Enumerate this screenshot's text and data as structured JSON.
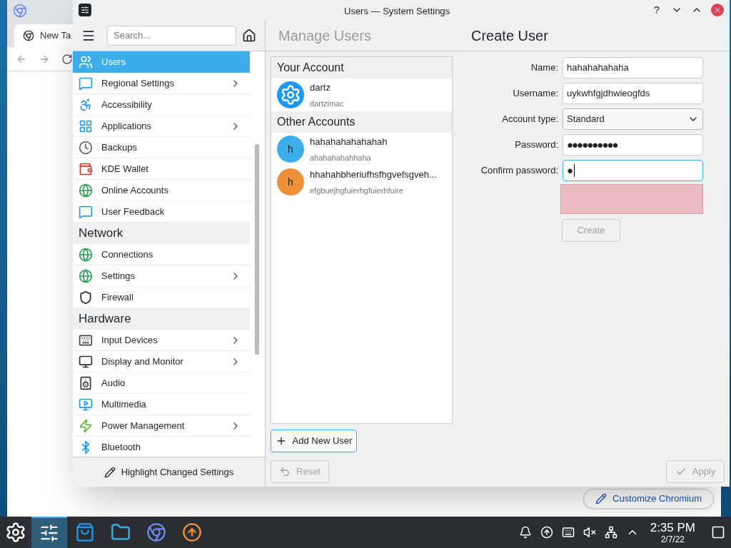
{
  "browser": {
    "tab_title": "New Ta",
    "customize_button": "Customize Chromium"
  },
  "window": {
    "title": "Users — System Settings",
    "help": "?"
  },
  "sidebar": {
    "search": {
      "placeholder": "Search..."
    },
    "groups": [
      {
        "items": [
          {
            "label": "Users",
            "selected": true,
            "has_children": false
          },
          {
            "label": "Regional Settings",
            "selected": false,
            "has_children": true
          },
          {
            "label": "Accessibility",
            "selected": false,
            "has_children": false
          },
          {
            "label": "Applications",
            "selected": false,
            "has_children": true
          },
          {
            "label": "Backups",
            "selected": false,
            "has_children": false
          },
          {
            "label": "KDE Wallet",
            "selected": false,
            "has_children": false
          },
          {
            "label": "Online Accounts",
            "selected": false,
            "has_children": false
          },
          {
            "label": "User Feedback",
            "selected": false,
            "has_children": false
          }
        ]
      },
      {
        "header": "Network",
        "items": [
          {
            "label": "Connections",
            "selected": false,
            "has_children": false
          },
          {
            "label": "Settings",
            "selected": false,
            "has_children": true
          },
          {
            "label": "Firewall",
            "selected": false,
            "has_children": false
          }
        ]
      },
      {
        "header": "Hardware",
        "items": [
          {
            "label": "Input Devices",
            "selected": false,
            "has_children": true
          },
          {
            "label": "Display and Monitor",
            "selected": false,
            "has_children": true
          },
          {
            "label": "Audio",
            "selected": false,
            "has_children": false
          },
          {
            "label": "Multimedia",
            "selected": false,
            "has_children": false
          },
          {
            "label": "Power Management",
            "selected": false,
            "has_children": true
          },
          {
            "label": "Bluetooth",
            "selected": false,
            "has_children": false
          }
        ]
      }
    ],
    "footer_button": "Highlight Changed Settings"
  },
  "breadcrumbs": [
    {
      "label": "Manage Users",
      "active": false
    },
    {
      "label": "Create User",
      "active": true
    }
  ],
  "accounts": [
    {
      "header": "Your Account",
      "users": [
        {
          "kind": "logo",
          "name": "dartz",
          "username": "dartzimac"
        }
      ]
    },
    {
      "header": "Other Accounts",
      "users": [
        {
          "kind": "letter",
          "letter": "h",
          "color": "#3daee9",
          "name": "hahahahahahahah",
          "username": "ahahahahahhaha"
        },
        {
          "kind": "letter",
          "letter": "h",
          "color": "#f08f3a",
          "name": "hhahahbheriufhsfhgvefsgveh...",
          "username": "efgbuejhgfuierhgfuierhfuire"
        }
      ]
    }
  ],
  "add_user_button": "Add New User",
  "form": {
    "fields": [
      {
        "kind": "text",
        "label": "Name:",
        "value": "hahahahahaha",
        "focused": false
      },
      {
        "kind": "text",
        "label": "Username:",
        "value": "uykwhfgjdhwieogfds",
        "focused": false
      },
      {
        "kind": "select",
        "label": "Account type:",
        "value": "Standard",
        "focused": false
      },
      {
        "kind": "password",
        "label": "Password:",
        "value": "●●●●●●●●●●",
        "focused": false
      },
      {
        "kind": "password",
        "label": "Confirm password:",
        "value": "●",
        "focused": true
      }
    ],
    "error": true,
    "create_button": {
      "label": "Create",
      "disabled": true
    }
  },
  "footer": {
    "reset": {
      "label": "Reset",
      "disabled": true
    },
    "apply": {
      "label": "Apply",
      "disabled": true
    }
  },
  "taskbar": {
    "apps": [
      {
        "selected": true
      },
      {
        "selected": false
      },
      {
        "selected": false
      },
      {
        "selected": false
      },
      {
        "selected": false
      }
    ],
    "time": "2:35 PM",
    "date": "2/7/22"
  }
}
